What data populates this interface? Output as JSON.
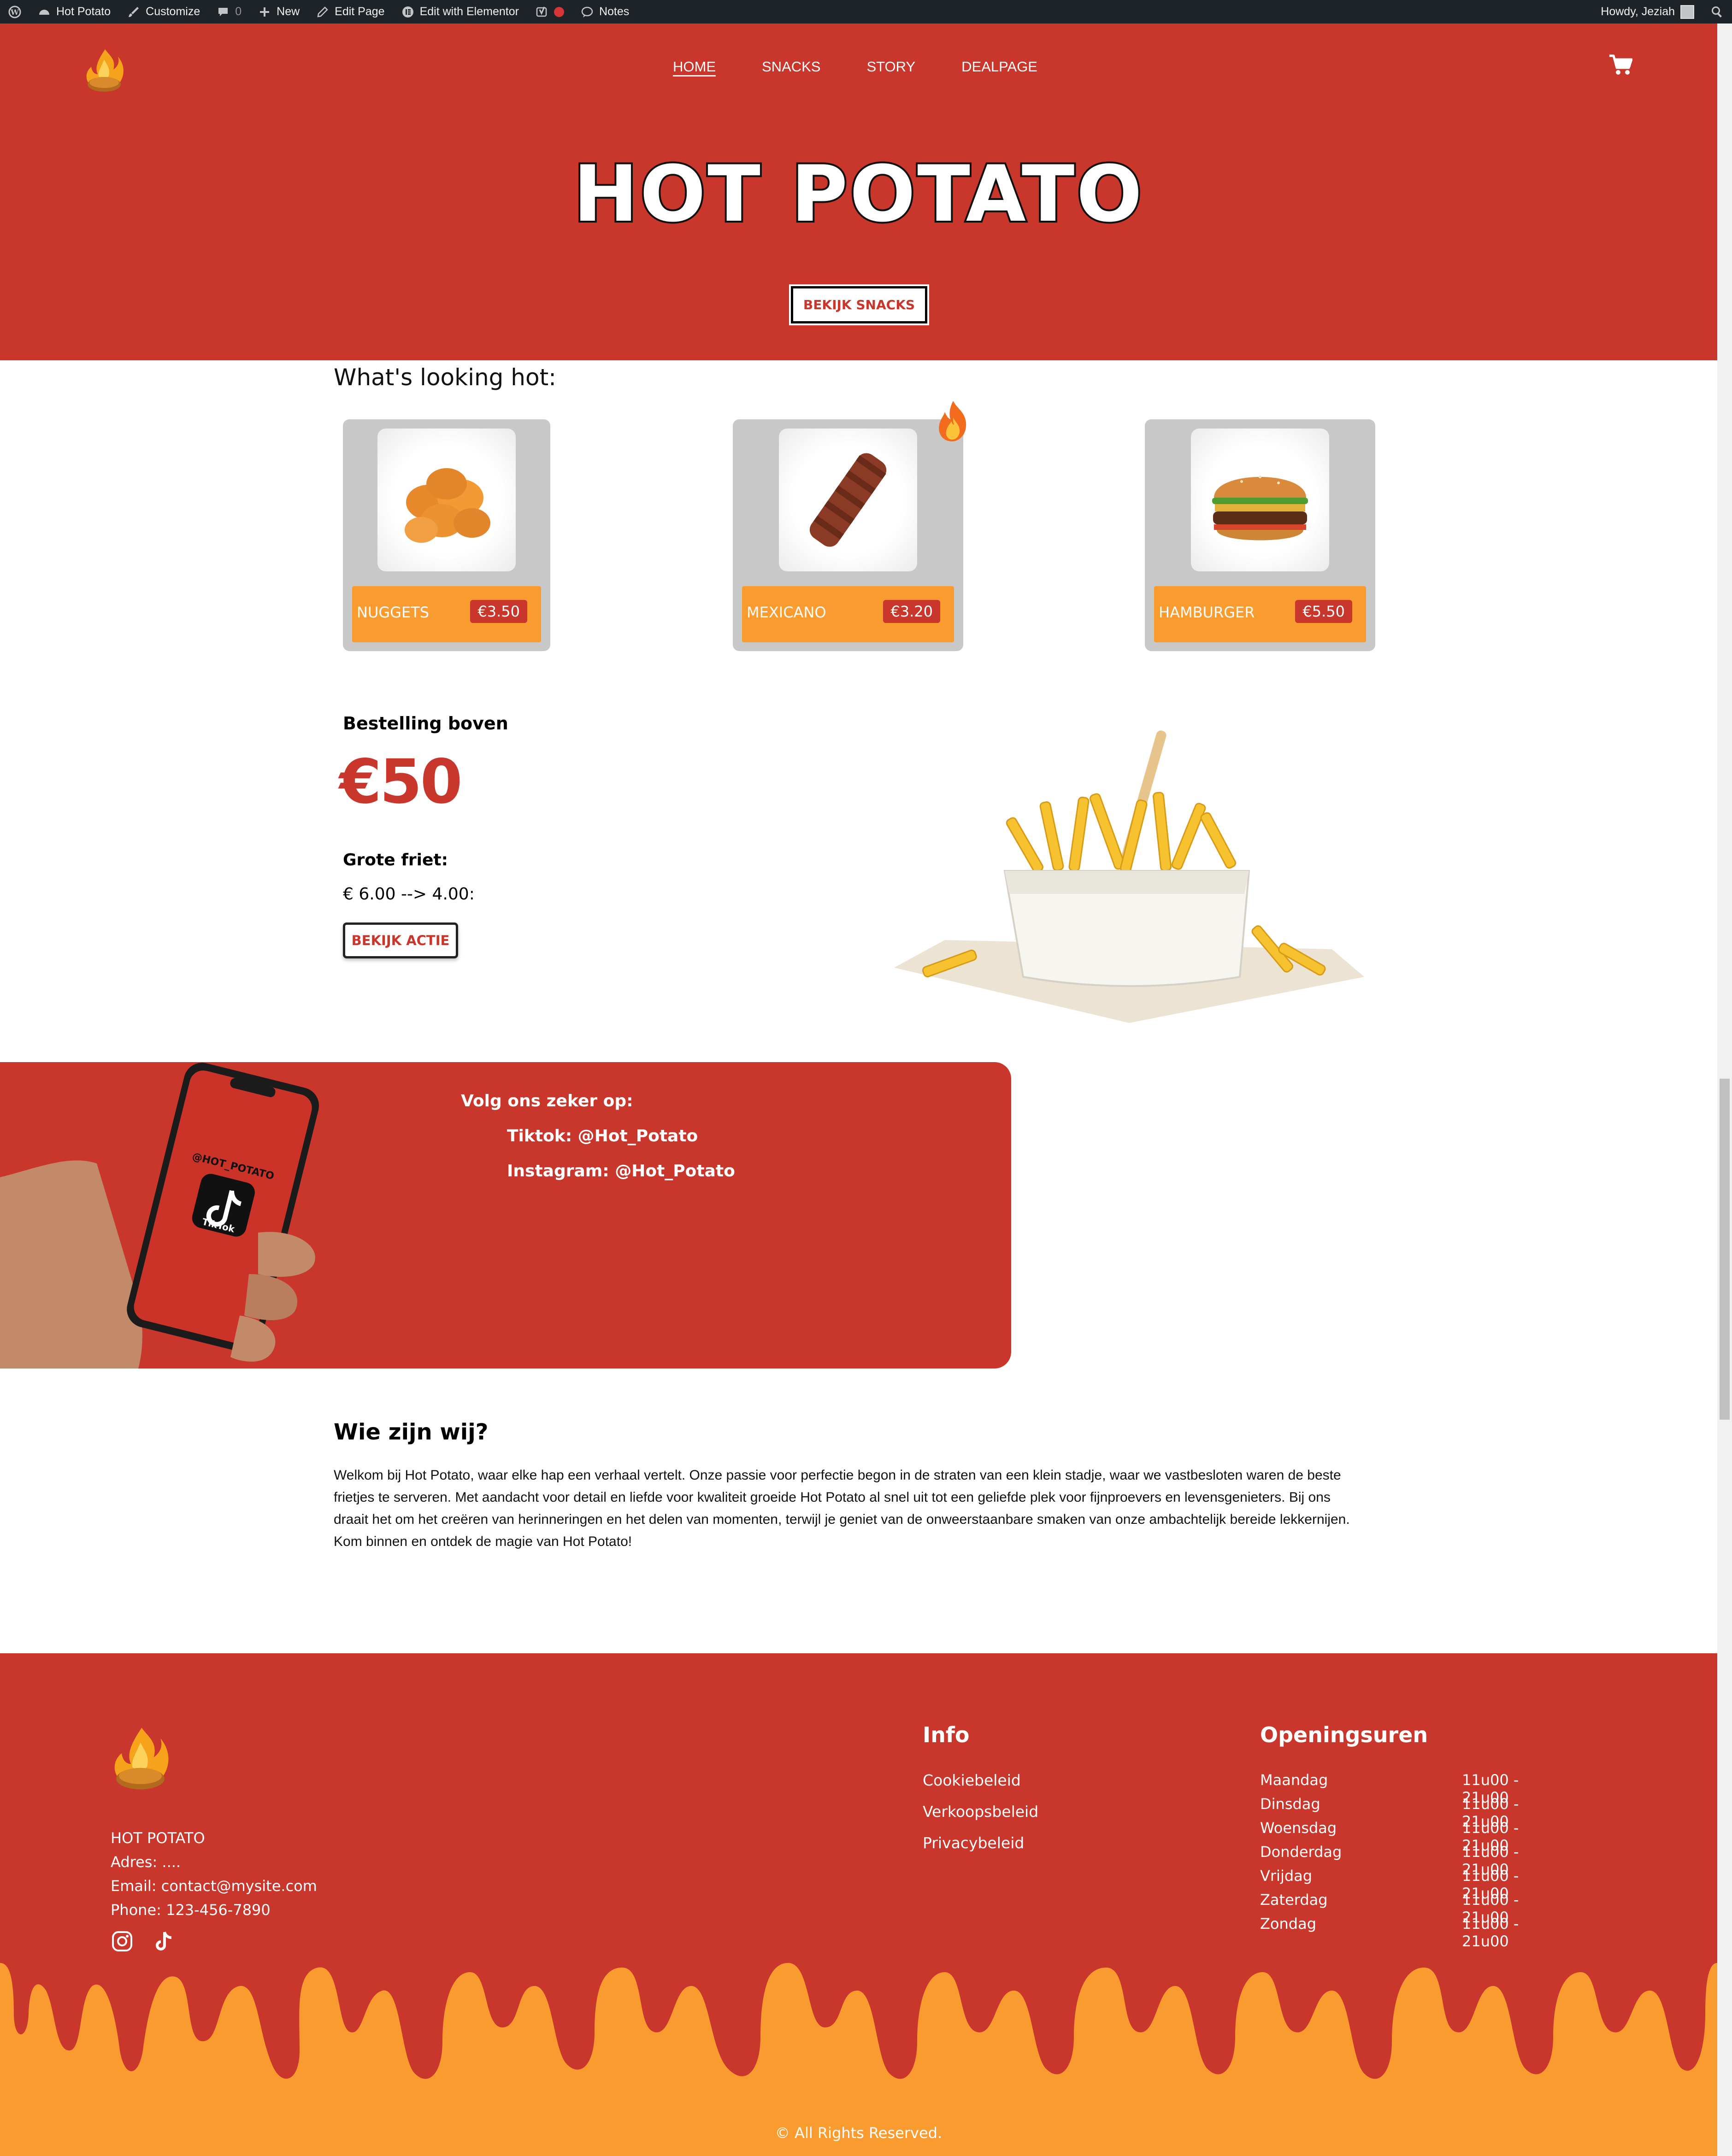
{
  "colors": {
    "brand_red": "#c9362b",
    "accent_orange": "#f99b2e",
    "admin_bar": "#1d2327"
  },
  "admin_bar": {
    "site_name": "Hot Potato",
    "customize": "Customize",
    "comments_count": "0",
    "new": "New",
    "edit_page": "Edit Page",
    "edit_elementor": "Edit with Elementor",
    "notes": "Notes",
    "howdy": "Howdy, Jeziah"
  },
  "nav": {
    "home": "HOME",
    "snacks": "SNACKS",
    "story": "STORY",
    "dealpage": "DEALPAGE"
  },
  "hero": {
    "title": "HOT POTATO",
    "button": "BEKIJK SNACKS"
  },
  "hot": {
    "title": "What's looking hot:",
    "items": [
      {
        "name": "NUGGETS",
        "price": "€3.50"
      },
      {
        "name": "MEXICANO",
        "price": "€3.20"
      },
      {
        "name": "HAMBURGER",
        "price": "€5.50"
      }
    ]
  },
  "deal": {
    "label": "Bestelling boven",
    "amount": "€50",
    "subtitle": "Grote friet:",
    "price": "€ 6.00 --> 4.00:",
    "button": "BEKIJK ACTIE"
  },
  "social": {
    "title": "Volg ons zeker op:",
    "tiktok": "Tiktok: @Hot_Potato",
    "instagram": "Instagram: @Hot_Potato",
    "phone_handle": "@HOT_POTATO",
    "phone_app": "TikTok"
  },
  "about": {
    "title": "Wie zijn wij?",
    "text": "Welkom bij Hot Potato, waar elke hap een verhaal vertelt. Onze passie voor perfectie begon in de straten van een klein stadje, waar we vastbesloten waren de beste frietjes te serveren. Met aandacht voor detail en liefde voor kwaliteit groeide Hot Potato al snel uit tot een geliefde plek voor fijnproevers en levensgenieters. Bij ons draait het om het creëren van herinneringen en het delen van momenten, terwijl je geniet van de onweerstaanbare smaken van onze ambachtelijk bereide lekkernijen. Kom binnen en ontdek de magie van Hot Potato!"
  },
  "footer": {
    "company": "HOT POTATO",
    "address": "Adres: ....",
    "email": "Email: contact@mysite.com",
    "phone": "Phone: 123-456-7890",
    "info_title": "Info",
    "links": [
      "Cookiebeleid",
      "Verkoopsbeleid",
      "Privacybeleid"
    ],
    "hours_title": "Openingsuren",
    "hours": [
      {
        "day": "Maandag",
        "time": "11u00 - 21u00"
      },
      {
        "day": "Dinsdag",
        "time": "11u00 - 21u00"
      },
      {
        "day": "Woensdag",
        "time": "11u00 - 21u00"
      },
      {
        "day": "Donderdag",
        "time": "11u00 - 21u00"
      },
      {
        "day": "Vrijdag",
        "time": "11u00 - 21u00"
      },
      {
        "day": "Zaterdag",
        "time": "11u00 - 21u00"
      },
      {
        "day": "Zondag",
        "time": "11u00 - 21u00"
      }
    ],
    "copyright": "© All Rights Reserved."
  }
}
